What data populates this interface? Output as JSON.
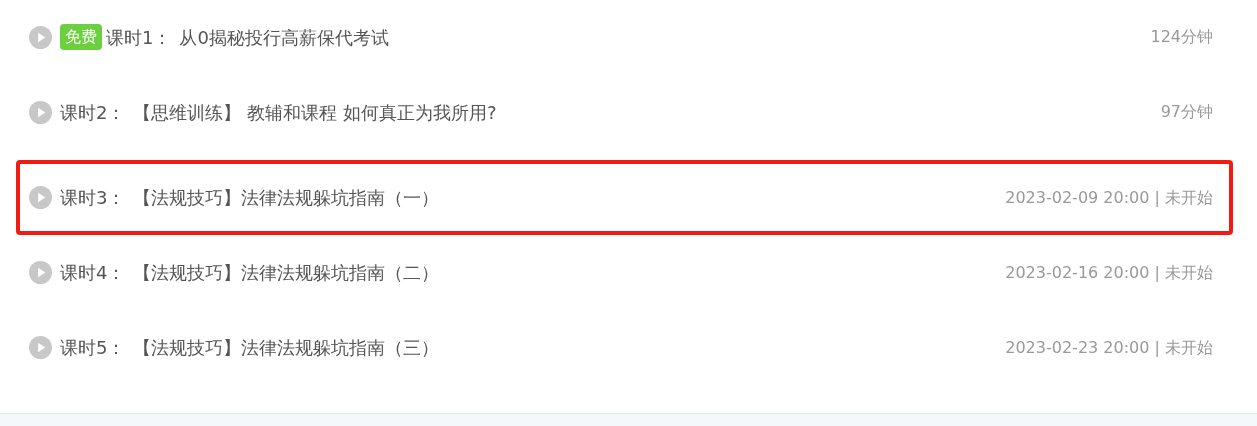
{
  "lessons": [
    {
      "badge": "免费",
      "label": "课时1：",
      "title": "从0揭秘投行高薪保代考试",
      "meta": "124分钟",
      "highlighted": false
    },
    {
      "label": "课时2：",
      "title": "【思维训练】 教辅和课程 如何真正为我所用?",
      "meta": "97分钟",
      "highlighted": false
    },
    {
      "label": "课时3：",
      "title": "【法规技巧】法律法规躲坑指南（一）",
      "meta": "2023-02-09 20:00 | 未开始",
      "highlighted": true
    },
    {
      "label": "课时4：",
      "title": "【法规技巧】法律法规躲坑指南（二）",
      "meta": "2023-02-16 20:00 | 未开始",
      "highlighted": false
    },
    {
      "label": "课时5：",
      "title": "【法规技巧】法律法规躲坑指南（三）",
      "meta": "2023-02-23 20:00 | 未开始",
      "highlighted": false
    }
  ]
}
